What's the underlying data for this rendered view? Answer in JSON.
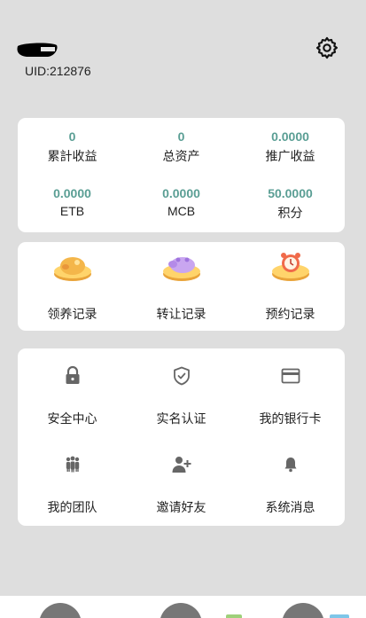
{
  "user": {
    "uid": "UID:212876"
  },
  "stats": [
    {
      "value": "0",
      "label": "累計收益"
    },
    {
      "value": "0",
      "label": "总资产"
    },
    {
      "value": "0.0000",
      "label": "推广收益"
    },
    {
      "value": "0.0000",
      "label": "ETB"
    },
    {
      "value": "0.0000",
      "label": "MCB"
    },
    {
      "value": "50.0000",
      "label": "积分"
    }
  ],
  "records": [
    {
      "label": "领养记录",
      "icon": "piggy-coin-icon"
    },
    {
      "label": "转让记录",
      "icon": "pig-transfer-icon"
    },
    {
      "label": "预约记录",
      "icon": "alarm-clock-icon"
    }
  ],
  "menu": [
    {
      "label": "安全中心",
      "icon": "lock-icon"
    },
    {
      "label": "实名认证",
      "icon": "shield-check-icon"
    },
    {
      "label": "我的银行卡",
      "icon": "bank-card-icon"
    },
    {
      "label": "我的团队",
      "icon": "team-icon"
    },
    {
      "label": "邀请好友",
      "icon": "add-user-icon"
    },
    {
      "label": "系统消息",
      "icon": "bell-icon"
    }
  ],
  "colors": {
    "stat_value": "#5a9e94",
    "background": "#dedede",
    "card": "#ffffff"
  }
}
